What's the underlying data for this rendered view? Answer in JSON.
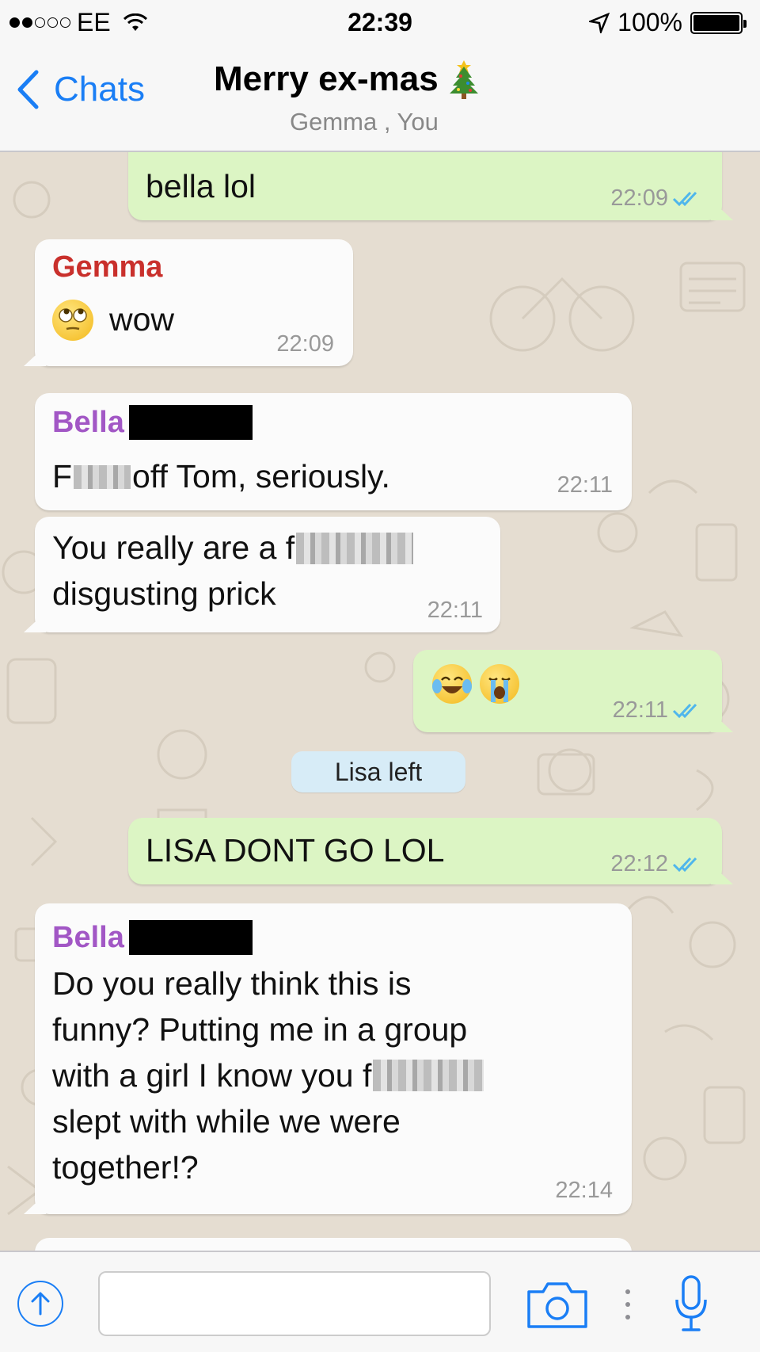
{
  "status_bar": {
    "carrier": "EE",
    "time": "22:39",
    "battery": "100%",
    "signal_dots_filled": 2,
    "signal_dots_total": 5
  },
  "nav": {
    "back_label": "Chats",
    "title": "Merry ex-mas",
    "title_emoji": "christmas-tree-icon",
    "subtitle": "Gemma , You"
  },
  "messages": [
    {
      "direction": "out",
      "text": "bella lol",
      "time": "22:09",
      "status": "read"
    },
    {
      "direction": "in",
      "sender": "Gemma",
      "sender_color": "#c9302c",
      "text": "wow",
      "emoji": "eye-roll-emoji-icon",
      "time": "22:09"
    },
    {
      "direction": "in",
      "sender": "Bella",
      "sender_color": "#a257c5",
      "sender_redacted": true,
      "text_before": "F",
      "text_after": " off Tom, seriously.",
      "time": "22:11"
    },
    {
      "direction": "in",
      "line1": "You really are a f",
      "line2": "disgusting prick",
      "time": "22:11"
    },
    {
      "direction": "out",
      "emoji": [
        "tears-of-joy-emoji-icon",
        "crying-emoji-icon"
      ],
      "time": "22:11",
      "status": "read"
    },
    {
      "direction": "system",
      "text": "Lisa  left"
    },
    {
      "direction": "out",
      "text": "LISA DONT GO LOL",
      "time": "22:12",
      "status": "read"
    },
    {
      "direction": "in",
      "sender": "Bella",
      "sender_color": "#a257c5",
      "sender_redacted": true,
      "lines": [
        "Do you really think this is",
        "funny? Putting me in a group",
        "with a girl I know you f",
        "slept with while we were",
        "together!?"
      ],
      "time": "22:14"
    }
  ],
  "input_bar": {
    "message_value": "",
    "icons": [
      "upload-icon",
      "camera-icon",
      "more-dots-icon",
      "microphone-icon"
    ]
  },
  "colors": {
    "accent": "#1a7ef5",
    "outgoing_bubble": "#dcf5c4",
    "incoming_bubble": "#fbfbfb",
    "read_ticks": "#4fb6ec",
    "wallpaper": "#e5ddd1"
  }
}
